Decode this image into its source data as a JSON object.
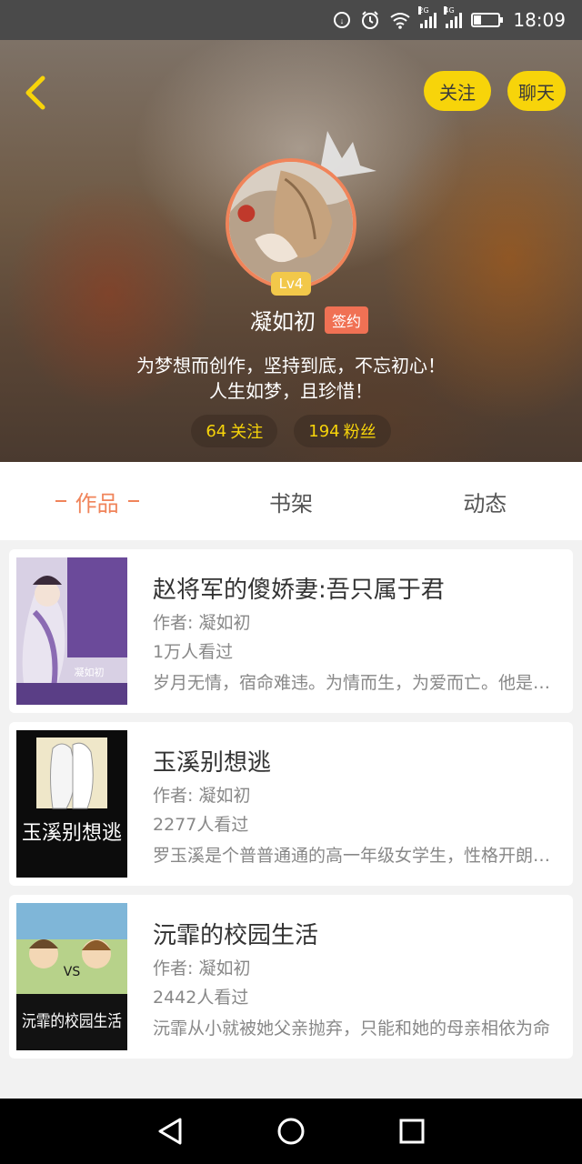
{
  "status_bar": {
    "time": "18:09",
    "network_1": "2G",
    "network_2": "4G",
    "icons": [
      "data-saver-icon",
      "alarm-icon",
      "wifi-icon",
      "signal-icon",
      "battery-icon"
    ]
  },
  "header": {
    "follow_label": "关注",
    "chat_label": "聊天",
    "level": "Lv4",
    "user_name": "凝如初",
    "sign_tag": "签约",
    "bio_line1": "为梦想而创作，坚持到底，不忘初心！",
    "bio_line2": "人生如梦，且珍惜！",
    "following_count": "64",
    "following_label": "关注",
    "fans_count": "194",
    "fans_label": "粉丝"
  },
  "tabs": [
    {
      "label": "作品",
      "active": true
    },
    {
      "label": "书架",
      "active": false
    },
    {
      "label": "动态",
      "active": false
    }
  ],
  "books": [
    {
      "title": "赵将军的傻娇妻:吾只属于君",
      "author": "作者: 凝如初",
      "views": "1万人看过",
      "desc": "岁月无情，宿命难违。为情而生，为爱而亡。他是权倾朝野的将军",
      "cover_text": "凝如初"
    },
    {
      "title": "玉溪别想逃",
      "author": "作者: 凝如初",
      "views": "2277人看过",
      "desc": "罗玉溪是个普普通通的高一年级女学生，性格开朗活泼",
      "cover_text": "玉溪别想逃"
    },
    {
      "title": "沅霏的校园生活",
      "author": "作者: 凝如初",
      "views": "2442人看过",
      "desc": "沅霏从小就被她父亲抛弃，只能和她的母亲相依为命",
      "cover_text": "沅霏的校园生活"
    }
  ],
  "colors": {
    "accent": "#f0845a",
    "yellow": "#f7d40a",
    "sign_tag": "#f07154"
  }
}
